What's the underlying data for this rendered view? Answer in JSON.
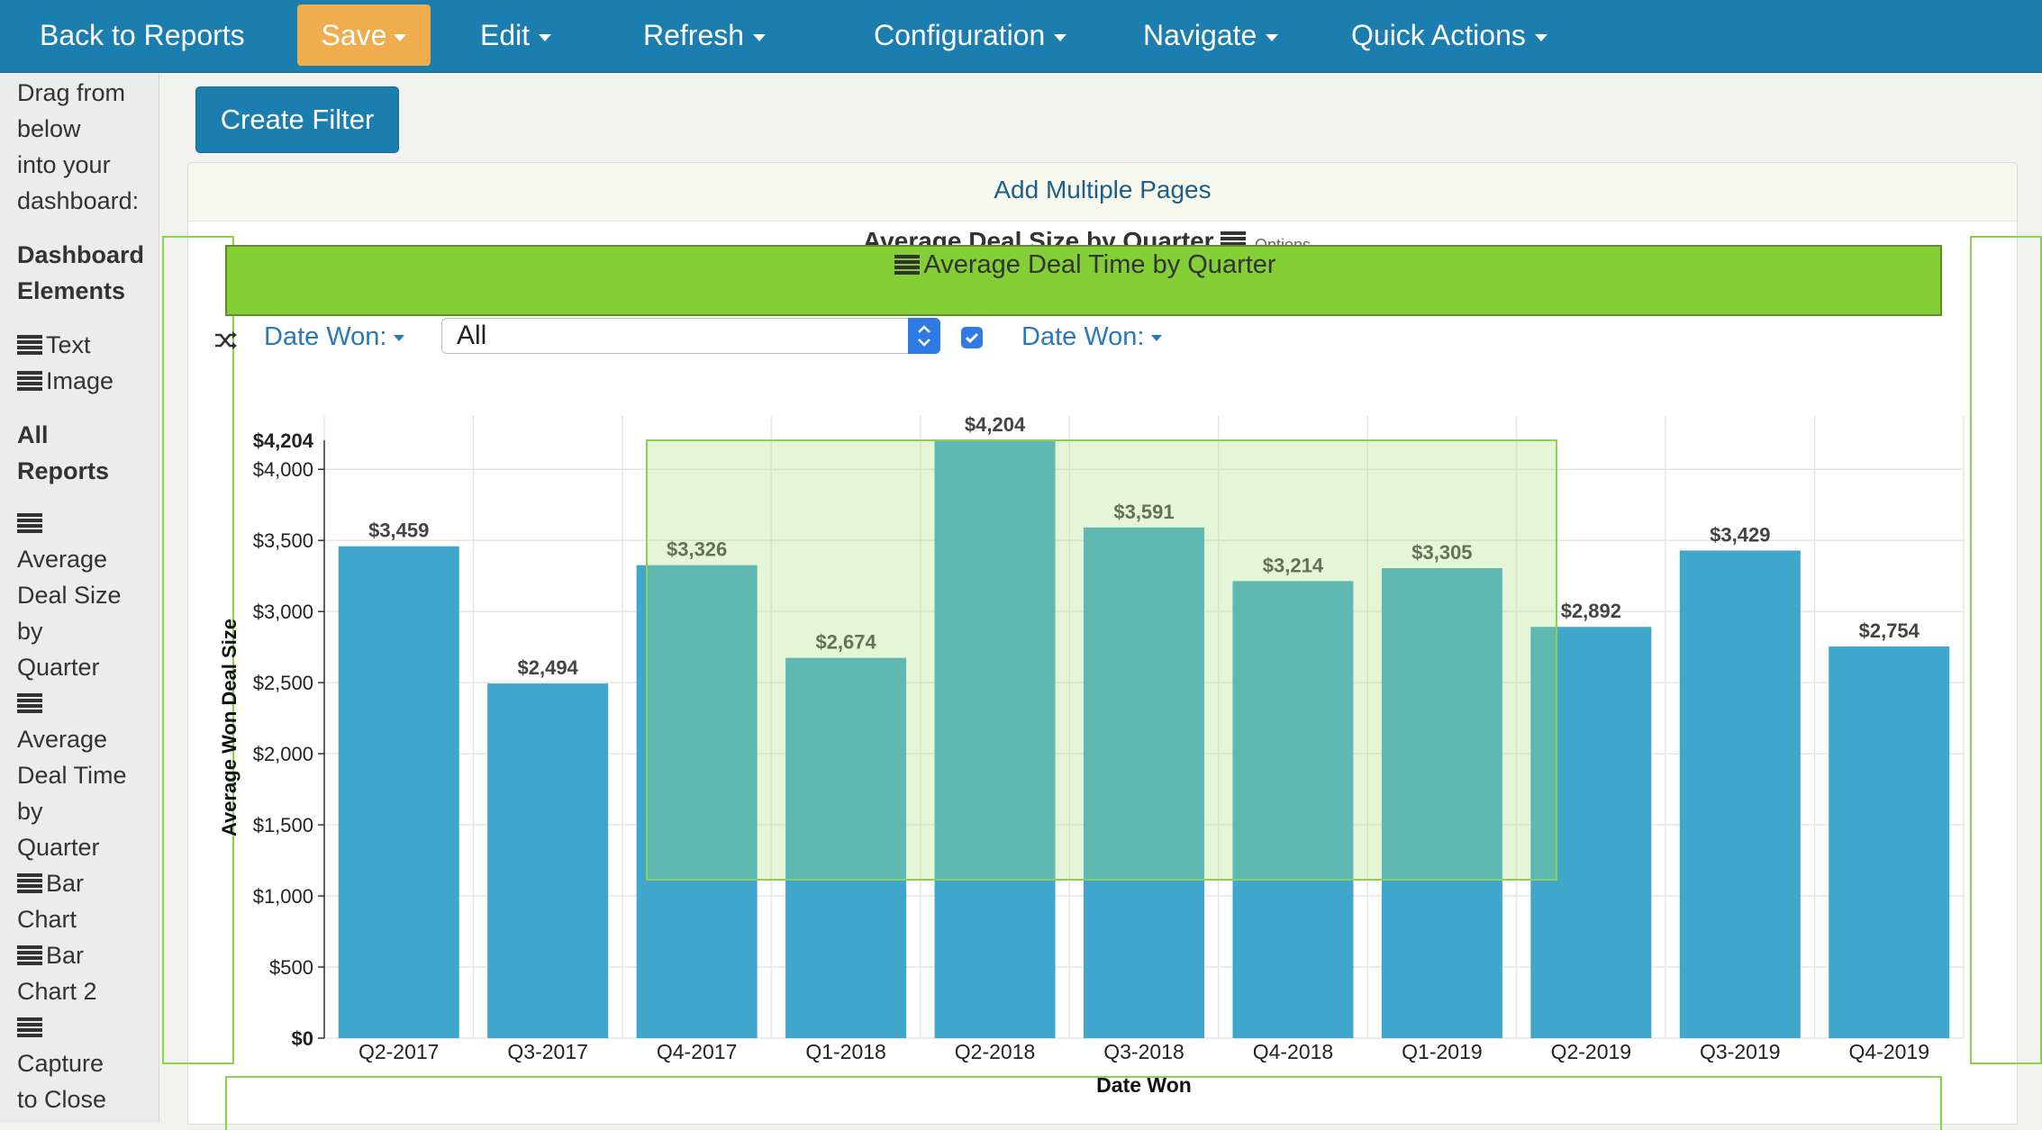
{
  "navbar": {
    "back_label": "Back to Reports",
    "save_label": "Save",
    "edit_label": "Edit",
    "refresh_label": "Refresh",
    "configuration_label": "Configuration",
    "navigate_label": "Navigate",
    "quick_actions_label": "Quick Actions",
    "bg_color": "#1b7eaf",
    "save_color": "#f0ad4e"
  },
  "sidebar": {
    "intro": [
      "Drag from",
      "below",
      "into your",
      "dashboard:"
    ],
    "elements_heading": [
      "Dashboard",
      "Elements"
    ],
    "elements": [
      {
        "icon": "list-icon",
        "label": "Text"
      },
      {
        "icon": "list-icon",
        "label": "Image"
      }
    ],
    "reports_heading": [
      "All",
      "Reports"
    ],
    "reports": [
      {
        "icon": "list-icon",
        "lines": [
          "Average",
          "Deal Size",
          "by",
          "Quarter"
        ]
      },
      {
        "icon": "list-icon",
        "lines": [
          "Average",
          "Deal Time",
          "by",
          "Quarter"
        ]
      },
      {
        "icon": "list-icon",
        "lines": [
          "Bar",
          "Chart"
        ]
      },
      {
        "icon": "list-icon",
        "lines": [
          "Bar",
          "Chart 2"
        ]
      },
      {
        "icon": "list-icon",
        "lines": [
          "Capture",
          "to Close"
        ]
      }
    ]
  },
  "toolbar": {
    "create_filter_label": "Create Filter"
  },
  "panel": {
    "add_pages_label": "Add Multiple Pages",
    "ghost_title": "Average Deal Size by Quarter",
    "ghost_options": "Options",
    "drag_title": "Average Deal Time by Quarter",
    "drag_color": "#83cf35"
  },
  "filters": {
    "date_won_label_1": "Date Won:",
    "select_value": "All",
    "checkbox_checked": true,
    "date_won_label_2": "Date Won:"
  },
  "chart_data": {
    "type": "bar",
    "title": "Average Deal Size by Quarter",
    "xlabel": "Date Won",
    "ylabel": "Average Won Deal Size",
    "categories": [
      "Q2-2017",
      "Q3-2017",
      "Q4-2017",
      "Q1-2018",
      "Q2-2018",
      "Q3-2018",
      "Q4-2018",
      "Q1-2019",
      "Q2-2019",
      "Q3-2019",
      "Q4-2019"
    ],
    "values": [
      3459,
      2494,
      3326,
      2674,
      4204,
      3591,
      3214,
      3305,
      2892,
      3429,
      2754
    ],
    "value_labels": [
      "$3,459",
      "$2,494",
      "$3,326",
      "$2,674",
      "$4,204",
      "$3,591",
      "$3,214",
      "$3,305",
      "$2,892",
      "$3,429",
      "$2,754"
    ],
    "yticks": [
      0,
      500,
      1000,
      1500,
      2000,
      2500,
      3000,
      3500,
      4000
    ],
    "ytick_labels": [
      "$0",
      "$500",
      "$1,000",
      "$1,500",
      "$2,000",
      "$2,500",
      "$3,000",
      "$3,500",
      "$4,000"
    ],
    "ymax_label": "$4,204",
    "ylim": [
      0,
      4204
    ],
    "bar_color": "#41a6cc",
    "grid": true
  }
}
